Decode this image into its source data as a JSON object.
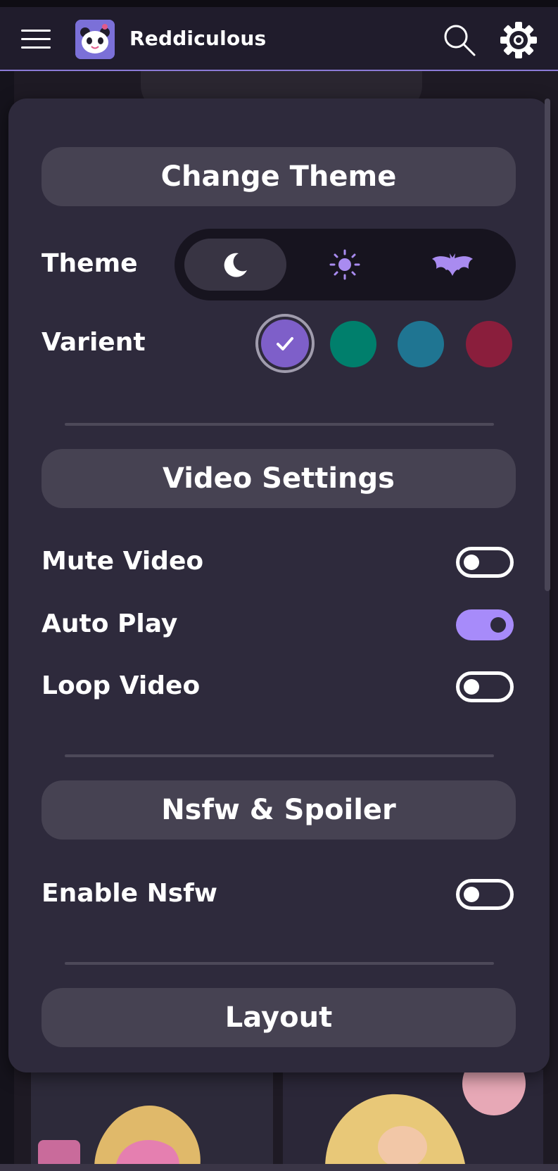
{
  "app": {
    "title": "Reddiculous",
    "accent_color": "#8b7bd6"
  },
  "header": {
    "menu_icon": "hamburger-menu-icon",
    "logo_icon": "panda-logo-icon",
    "search_icon": "search-icon",
    "settings_icon": "gear-icon"
  },
  "settings": {
    "change_theme": {
      "heading": "Change Theme",
      "theme_label": "Theme",
      "theme_options": [
        {
          "name": "dark",
          "icon": "moon-icon",
          "selected": true,
          "color": "#ffffff"
        },
        {
          "name": "light",
          "icon": "sun-icon",
          "selected": false,
          "color": "#a98bf0"
        },
        {
          "name": "spooky",
          "icon": "bat-icon",
          "selected": false,
          "color": "#a98bf0"
        }
      ],
      "variant_label": "Varient",
      "variants": [
        {
          "color": "#7e5fc9",
          "selected": true,
          "icon": "checkmark-icon"
        },
        {
          "color": "#007f6c",
          "selected": false
        },
        {
          "color": "#1f7592",
          "selected": false
        },
        {
          "color": "#8a1e3c",
          "selected": false
        }
      ]
    },
    "video_settings": {
      "heading": "Video Settings",
      "toggles": [
        {
          "label": "Mute Video",
          "on": false
        },
        {
          "label": "Auto Play",
          "on": true
        },
        {
          "label": "Loop Video",
          "on": false
        }
      ],
      "on_color": "#a78bfa"
    },
    "nsfw_spoiler": {
      "heading": "Nsfw & Spoiler",
      "toggles": [
        {
          "label": "Enable Nsfw",
          "on": false
        }
      ]
    },
    "layout": {
      "heading": "Layout"
    }
  }
}
